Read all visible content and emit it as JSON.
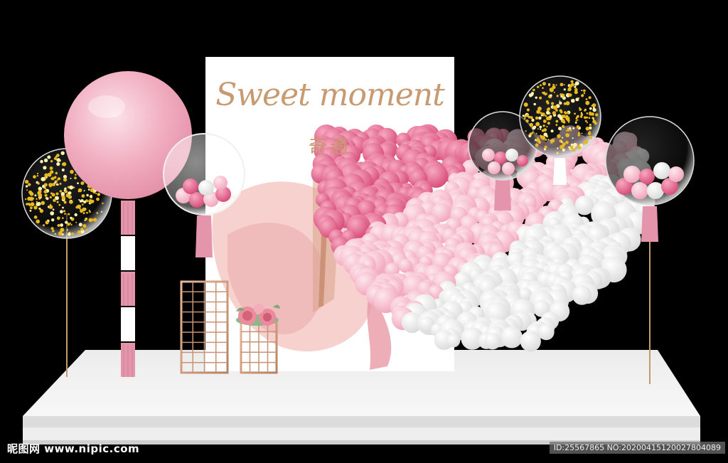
{
  "backdrop": {
    "title": "Sweet moment",
    "subtitle": "奇遇"
  },
  "watermark": {
    "site": "昵图网 www.nipic.com",
    "id_text": "ID:25567865 NO:20200415120027804089"
  },
  "colors": {
    "background": "#000000",
    "stage": "#f2f2f2",
    "backdrop_panel": "#ffffff",
    "pink_balloon": "#f4b3c4",
    "hot_pink": "#e06c90",
    "gold_confetti": "#e6b21a",
    "rose_gold": "#c8996e"
  }
}
